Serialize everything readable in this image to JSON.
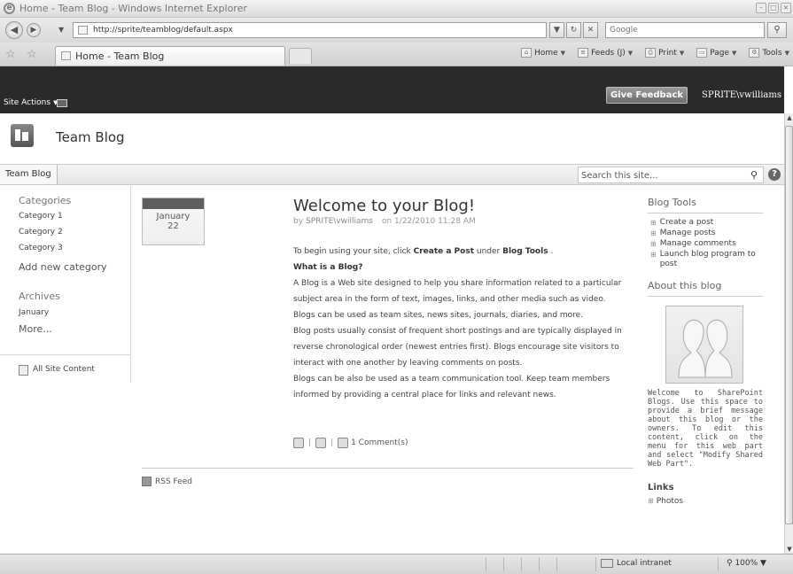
{
  "browser": {
    "window_title": "Home - Team Blog - Windows Internet Explorer",
    "address_url": "http://sprite/teamblog/default.aspx",
    "search_placeholder": "Google",
    "tab_title": "Home - Team Blog",
    "commands": [
      {
        "label": "Home",
        "icon": "home-icon"
      },
      {
        "label": "Feeds (J)",
        "icon": "feeds-icon"
      },
      {
        "label": "Print",
        "icon": "print-icon"
      },
      {
        "label": "Page",
        "icon": "page-icon"
      },
      {
        "label": "Tools",
        "icon": "tools-icon"
      }
    ]
  },
  "ribbon": {
    "site_actions": "Site Actions",
    "give_feedback": "Give Feedback",
    "user": "SPRITE\\vwilliams"
  },
  "site": {
    "title": "Team Blog",
    "nav_tab": "Team Blog",
    "search_value": "Search this site..."
  },
  "leftnav": {
    "categories_heading": "Categories",
    "categories": [
      "Category 1",
      "Category 2",
      "Category 3"
    ],
    "add_category": "Add new category",
    "archives_heading": "Archives",
    "archive_months": [
      "January"
    ],
    "more": "More...",
    "all_site_content": "All Site Content"
  },
  "post": {
    "date_month": "January",
    "date_day": "22",
    "title": "Welcome to your Blog!",
    "by": "by",
    "author": "SPRITE\\vwilliams",
    "posted": "on 1/22/2010 11:28 AM",
    "intro_start": "To begin using your site, click ",
    "intro_link1": "Create a Post",
    "intro_mid": " under ",
    "intro_link2": "Blog Tools",
    "intro_end": " .",
    "what_heading": "What is a Blog?",
    "para1": "A Blog is a Web site designed to help you share information related to a particular subject area in the form of text, images, links, and other media such as video. Blogs can be used as team sites, news sites, journals, diaries, and more.",
    "para2": "Blog posts usually consist of frequent short postings and are typically displayed in reverse chronological order (newest entries first). Blogs encourage site visitors to interact with one another by leaving comments on posts.",
    "para3": "Blogs can be also be used as a team communication tool. Keep team members informed by providing a central place for links and relevant news.",
    "comments": "1 Comment(s)"
  },
  "rss_feed": "RSS Feed",
  "blog_tools": {
    "heading": "Blog Tools",
    "items": [
      "Create a post",
      "Manage posts",
      "Manage comments",
      "Launch blog program to post"
    ]
  },
  "about": {
    "heading": "About this blog",
    "description": "Welcome to SharePoint Blogs. Use this space to provide a brief message about this blog or the owners. To edit this content, click on the menu for this web part and select \"Modify Shared Web Part\"."
  },
  "links": {
    "heading": "Links",
    "items": [
      "Photos"
    ]
  },
  "statusbar": {
    "zone": "Local intranet",
    "zoom": "100%"
  }
}
